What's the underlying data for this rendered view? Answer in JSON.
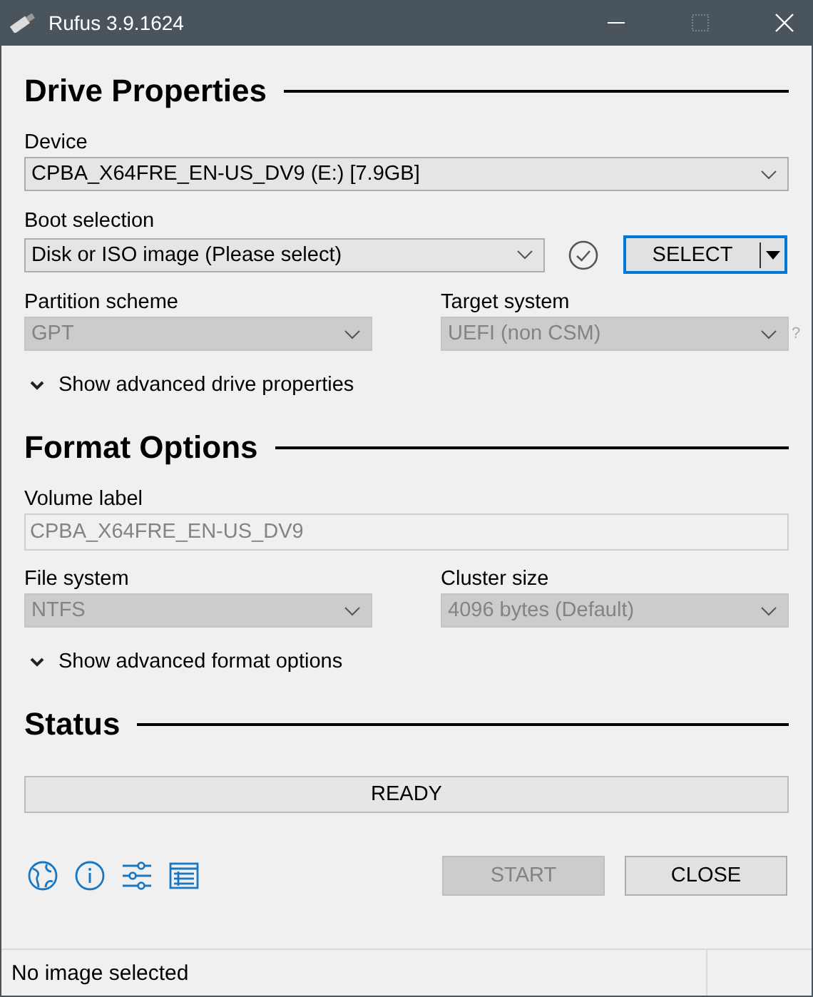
{
  "window": {
    "title": "Rufus 3.9.1624"
  },
  "sections": [
    {
      "title": "Drive Properties",
      "rows": [
        {
          "kind": "select",
          "label": "Device",
          "value": "CPBA_X64FRE_EN-US_DV9 (E:) [7.9GB]",
          "disabled": false
        },
        {
          "kind": "boot",
          "label": "Boot selection",
          "value": "Disk or ISO image (Please select)",
          "disabled": false,
          "button": "SELECT"
        },
        {
          "kind": "pair",
          "fields": [
            {
              "label": "Partition scheme",
              "value": "GPT",
              "disabled": true
            },
            {
              "label": "Target system",
              "value": "UEFI (non CSM)",
              "disabled": true,
              "help": "?"
            }
          ]
        },
        {
          "kind": "toggle",
          "label": "Show advanced drive properties",
          "expanded": false
        }
      ]
    },
    {
      "title": "Format Options",
      "rows": [
        {
          "kind": "text",
          "label": "Volume label",
          "value": "CPBA_X64FRE_EN-US_DV9",
          "disabled": true
        },
        {
          "kind": "pair",
          "fields": [
            {
              "label": "File system",
              "value": "NTFS",
              "disabled": true
            },
            {
              "label": "Cluster size",
              "value": "4096 bytes (Default)",
              "disabled": true
            }
          ]
        },
        {
          "kind": "toggle",
          "label": "Show advanced format options",
          "expanded": false
        }
      ]
    },
    {
      "title": "Status",
      "rows": [
        {
          "kind": "progress",
          "text": "READY",
          "level": 0
        }
      ]
    }
  ],
  "buttons": [
    {
      "label": "START",
      "disabled": true
    },
    {
      "label": "CLOSE",
      "disabled": false
    }
  ],
  "status_bar": {
    "text": "No image selected"
  }
}
